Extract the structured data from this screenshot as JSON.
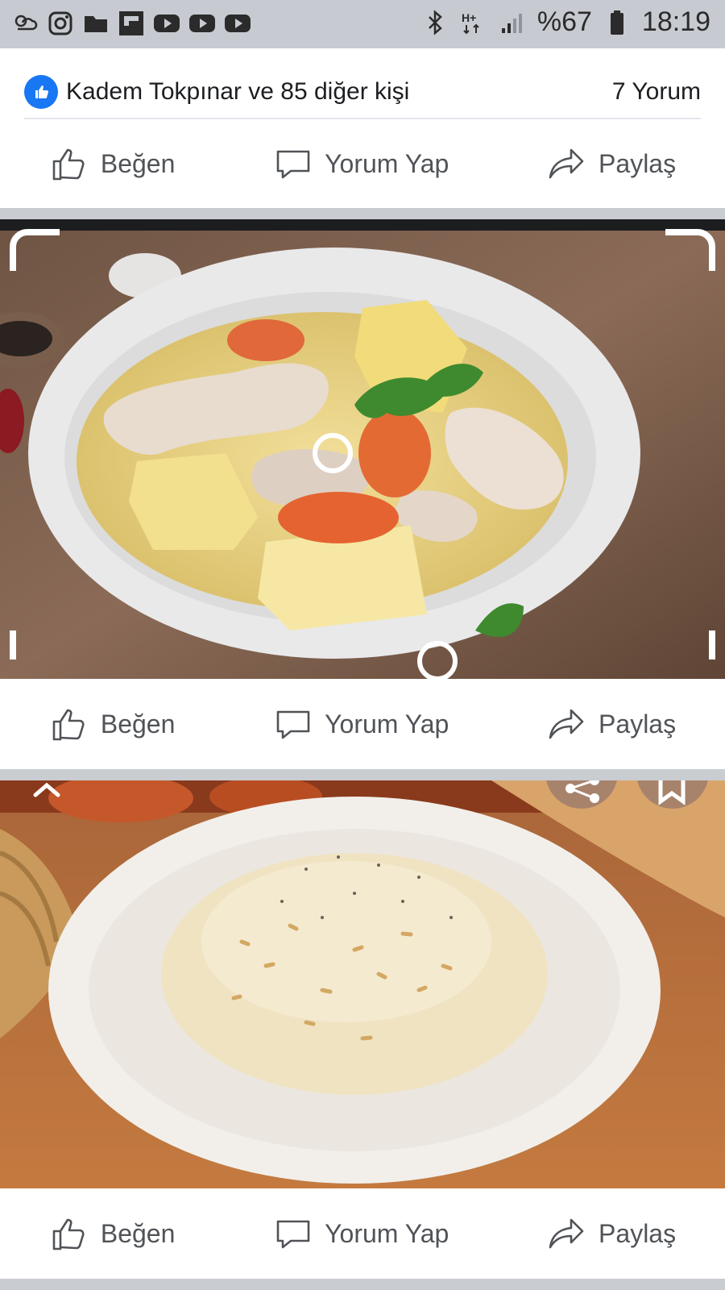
{
  "status_bar": {
    "battery": "%67",
    "time": "18:19",
    "left_icons": [
      "weather-icon",
      "instagram-icon",
      "folder-icon",
      "flipboard-icon",
      "youtube-icon",
      "youtube-icon",
      "youtube-icon"
    ],
    "right_icons": [
      "bluetooth-icon",
      "network-hplus-icon",
      "signal-icon",
      "battery-icon"
    ]
  },
  "post1": {
    "reactions_text": "Kadem Tokpınar ve 85 diğer kişi",
    "comments_text": "7 Yorum"
  },
  "actions": {
    "like": "Beğen",
    "comment": "Yorum Yap",
    "share": "Paylaş"
  },
  "colors": {
    "facebook_blue": "#1877f2",
    "action_gray": "#505357",
    "feed_bg": "#c9ccd1"
  }
}
